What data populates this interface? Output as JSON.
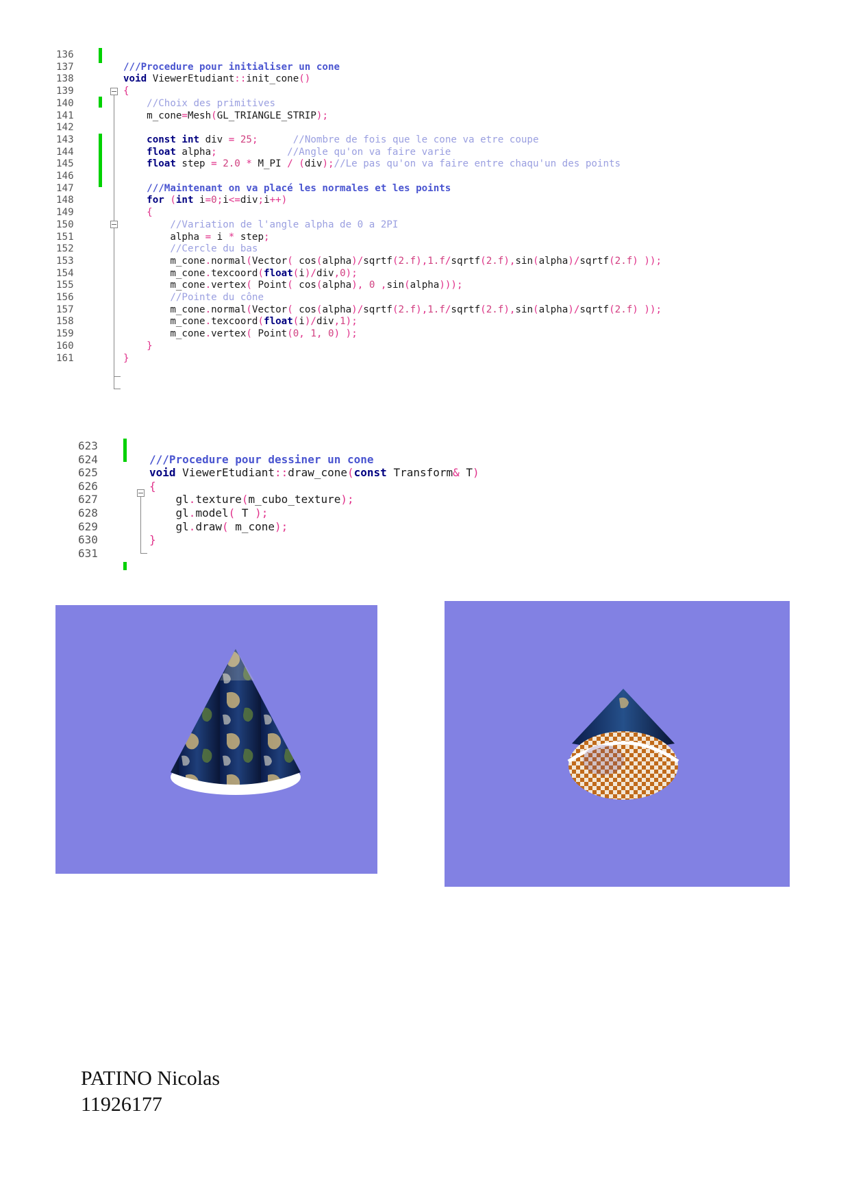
{
  "code_block_1": {
    "lines": [
      {
        "num": "136",
        "tokens": []
      },
      {
        "num": "137",
        "tokens": [
          {
            "t": "///Procedure pour initialiser un cone",
            "c": "t-dc"
          }
        ]
      },
      {
        "num": "138",
        "tokens": [
          {
            "t": "void",
            "c": "t-kw"
          },
          {
            "t": " ViewerEtudiant",
            "c": "t-pl"
          },
          {
            "t": "::",
            "c": "t-op"
          },
          {
            "t": "init_cone",
            "c": "t-pl"
          },
          {
            "t": "()",
            "c": "t-op"
          }
        ]
      },
      {
        "num": "139",
        "tokens": [
          {
            "t": "{",
            "c": "t-op"
          }
        ]
      },
      {
        "num": "140",
        "tokens": [
          {
            "t": "    //Choix des primitives",
            "c": "t-cm"
          }
        ]
      },
      {
        "num": "141",
        "tokens": [
          {
            "t": "    m_cone",
            "c": "t-pl"
          },
          {
            "t": "=",
            "c": "t-op"
          },
          {
            "t": "Mesh",
            "c": "t-pl"
          },
          {
            "t": "(",
            "c": "t-op"
          },
          {
            "t": "GL_TRIANGLE_STRIP",
            "c": "t-pl"
          },
          {
            "t": ");",
            "c": "t-op"
          }
        ]
      },
      {
        "num": "142",
        "tokens": []
      },
      {
        "num": "143",
        "tokens": [
          {
            "t": "    const int",
            "c": "t-kw"
          },
          {
            "t": " div ",
            "c": "t-pl"
          },
          {
            "t": "=",
            "c": "t-op"
          },
          {
            "t": " 25",
            "c": "t-nm"
          },
          {
            "t": ";",
            "c": "t-op"
          },
          {
            "t": "      //Nombre de fois que le cone va etre coupe",
            "c": "t-cm"
          }
        ]
      },
      {
        "num": "144",
        "tokens": [
          {
            "t": "    float",
            "c": "t-kw"
          },
          {
            "t": " alpha",
            "c": "t-pl"
          },
          {
            "t": ";",
            "c": "t-op"
          },
          {
            "t": "            //Angle qu'on va faire varie",
            "c": "t-cm"
          }
        ]
      },
      {
        "num": "145",
        "tokens": [
          {
            "t": "    float",
            "c": "t-kw"
          },
          {
            "t": " step ",
            "c": "t-pl"
          },
          {
            "t": "=",
            "c": "t-op"
          },
          {
            "t": " 2.0",
            "c": "t-nm"
          },
          {
            "t": " * ",
            "c": "t-op"
          },
          {
            "t": "M_PI ",
            "c": "t-pl"
          },
          {
            "t": "/",
            "c": "t-op"
          },
          {
            "t": " (",
            "c": "t-op"
          },
          {
            "t": "div",
            "c": "t-pl"
          },
          {
            "t": ");",
            "c": "t-op"
          },
          {
            "t": "//Le pas qu'on va faire entre chaqu'un des points",
            "c": "t-cm"
          }
        ]
      },
      {
        "num": "146",
        "tokens": []
      },
      {
        "num": "147",
        "tokens": [
          {
            "t": "    ///Maintenant on va placé les normales et les points",
            "c": "t-dc"
          }
        ]
      },
      {
        "num": "148",
        "tokens": [
          {
            "t": "    for",
            "c": "t-kw"
          },
          {
            "t": " (",
            "c": "t-op"
          },
          {
            "t": "int",
            "c": "t-kw"
          },
          {
            "t": " i",
            "c": "t-pl"
          },
          {
            "t": "=",
            "c": "t-op"
          },
          {
            "t": "0",
            "c": "t-nm"
          },
          {
            "t": ";",
            "c": "t-op"
          },
          {
            "t": "i",
            "c": "t-pl"
          },
          {
            "t": "<=",
            "c": "t-op"
          },
          {
            "t": "div",
            "c": "t-pl"
          },
          {
            "t": ";",
            "c": "t-op"
          },
          {
            "t": "i",
            "c": "t-pl"
          },
          {
            "t": "++)",
            "c": "t-op"
          }
        ]
      },
      {
        "num": "149",
        "tokens": [
          {
            "t": "    {",
            "c": "t-op"
          }
        ]
      },
      {
        "num": "150",
        "tokens": [
          {
            "t": "        //Variation de l'angle alpha de 0 a 2PI",
            "c": "t-cm"
          }
        ]
      },
      {
        "num": "151",
        "tokens": [
          {
            "t": "        alpha ",
            "c": "t-pl"
          },
          {
            "t": "=",
            "c": "t-op"
          },
          {
            "t": " i ",
            "c": "t-pl"
          },
          {
            "t": "*",
            "c": "t-op"
          },
          {
            "t": " step",
            "c": "t-pl"
          },
          {
            "t": ";",
            "c": "t-op"
          }
        ]
      },
      {
        "num": "152",
        "tokens": [
          {
            "t": "        //Cercle du bas",
            "c": "t-cm"
          }
        ]
      },
      {
        "num": "153",
        "tokens": [
          {
            "t": "        m_cone",
            "c": "t-pl"
          },
          {
            "t": ".",
            "c": "t-op"
          },
          {
            "t": "normal",
            "c": "t-pl"
          },
          {
            "t": "(",
            "c": "t-op"
          },
          {
            "t": "Vector",
            "c": "t-pl"
          },
          {
            "t": "( ",
            "c": "t-op"
          },
          {
            "t": "cos",
            "c": "t-pl"
          },
          {
            "t": "(",
            "c": "t-op"
          },
          {
            "t": "alpha",
            "c": "t-pl"
          },
          {
            "t": ")/",
            "c": "t-op"
          },
          {
            "t": "sqrtf",
            "c": "t-pl"
          },
          {
            "t": "(",
            "c": "t-op"
          },
          {
            "t": "2.f",
            "c": "t-nm"
          },
          {
            "t": "),",
            "c": "t-op"
          },
          {
            "t": "1.f",
            "c": "t-nm"
          },
          {
            "t": "/",
            "c": "t-op"
          },
          {
            "t": "sqrtf",
            "c": "t-pl"
          },
          {
            "t": "(",
            "c": "t-op"
          },
          {
            "t": "2.f",
            "c": "t-nm"
          },
          {
            "t": "),",
            "c": "t-op"
          },
          {
            "t": "sin",
            "c": "t-pl"
          },
          {
            "t": "(",
            "c": "t-op"
          },
          {
            "t": "alpha",
            "c": "t-pl"
          },
          {
            "t": ")/",
            "c": "t-op"
          },
          {
            "t": "sqrtf",
            "c": "t-pl"
          },
          {
            "t": "(",
            "c": "t-op"
          },
          {
            "t": "2.f",
            "c": "t-nm"
          },
          {
            "t": ") ));",
            "c": "t-op"
          }
        ]
      },
      {
        "num": "154",
        "tokens": [
          {
            "t": "        m_cone",
            "c": "t-pl"
          },
          {
            "t": ".",
            "c": "t-op"
          },
          {
            "t": "texcoord",
            "c": "t-pl"
          },
          {
            "t": "(",
            "c": "t-op"
          },
          {
            "t": "float",
            "c": "t-kw"
          },
          {
            "t": "(",
            "c": "t-op"
          },
          {
            "t": "i",
            "c": "t-pl"
          },
          {
            "t": ")/",
            "c": "t-op"
          },
          {
            "t": "div",
            "c": "t-pl"
          },
          {
            "t": ",",
            "c": "t-op"
          },
          {
            "t": "0",
            "c": "t-nm"
          },
          {
            "t": ");",
            "c": "t-op"
          }
        ]
      },
      {
        "num": "155",
        "tokens": [
          {
            "t": "        m_cone",
            "c": "t-pl"
          },
          {
            "t": ".",
            "c": "t-op"
          },
          {
            "t": "vertex",
            "c": "t-pl"
          },
          {
            "t": "( ",
            "c": "t-op"
          },
          {
            "t": "Point",
            "c": "t-pl"
          },
          {
            "t": "( ",
            "c": "t-op"
          },
          {
            "t": "cos",
            "c": "t-pl"
          },
          {
            "t": "(",
            "c": "t-op"
          },
          {
            "t": "alpha",
            "c": "t-pl"
          },
          {
            "t": "), ",
            "c": "t-op"
          },
          {
            "t": "0",
            "c": "t-nm"
          },
          {
            "t": " ,",
            "c": "t-op"
          },
          {
            "t": "sin",
            "c": "t-pl"
          },
          {
            "t": "(",
            "c": "t-op"
          },
          {
            "t": "alpha",
            "c": "t-pl"
          },
          {
            "t": ")));",
            "c": "t-op"
          }
        ]
      },
      {
        "num": "156",
        "tokens": [
          {
            "t": "        //Pointe du cône",
            "c": "t-cm"
          }
        ]
      },
      {
        "num": "157",
        "tokens": [
          {
            "t": "        m_cone",
            "c": "t-pl"
          },
          {
            "t": ".",
            "c": "t-op"
          },
          {
            "t": "normal",
            "c": "t-pl"
          },
          {
            "t": "(",
            "c": "t-op"
          },
          {
            "t": "Vector",
            "c": "t-pl"
          },
          {
            "t": "( ",
            "c": "t-op"
          },
          {
            "t": "cos",
            "c": "t-pl"
          },
          {
            "t": "(",
            "c": "t-op"
          },
          {
            "t": "alpha",
            "c": "t-pl"
          },
          {
            "t": ")/",
            "c": "t-op"
          },
          {
            "t": "sqrtf",
            "c": "t-pl"
          },
          {
            "t": "(",
            "c": "t-op"
          },
          {
            "t": "2.f",
            "c": "t-nm"
          },
          {
            "t": "),",
            "c": "t-op"
          },
          {
            "t": "1.f",
            "c": "t-nm"
          },
          {
            "t": "/",
            "c": "t-op"
          },
          {
            "t": "sqrtf",
            "c": "t-pl"
          },
          {
            "t": "(",
            "c": "t-op"
          },
          {
            "t": "2.f",
            "c": "t-nm"
          },
          {
            "t": "),",
            "c": "t-op"
          },
          {
            "t": "sin",
            "c": "t-pl"
          },
          {
            "t": "(",
            "c": "t-op"
          },
          {
            "t": "alpha",
            "c": "t-pl"
          },
          {
            "t": ")/",
            "c": "t-op"
          },
          {
            "t": "sqrtf",
            "c": "t-pl"
          },
          {
            "t": "(",
            "c": "t-op"
          },
          {
            "t": "2.f",
            "c": "t-nm"
          },
          {
            "t": ") ));",
            "c": "t-op"
          }
        ]
      },
      {
        "num": "158",
        "tokens": [
          {
            "t": "        m_cone",
            "c": "t-pl"
          },
          {
            "t": ".",
            "c": "t-op"
          },
          {
            "t": "texcoord",
            "c": "t-pl"
          },
          {
            "t": "(",
            "c": "t-op"
          },
          {
            "t": "float",
            "c": "t-kw"
          },
          {
            "t": "(",
            "c": "t-op"
          },
          {
            "t": "i",
            "c": "t-pl"
          },
          {
            "t": ")/",
            "c": "t-op"
          },
          {
            "t": "div",
            "c": "t-pl"
          },
          {
            "t": ",",
            "c": "t-op"
          },
          {
            "t": "1",
            "c": "t-nm"
          },
          {
            "t": ");",
            "c": "t-op"
          }
        ]
      },
      {
        "num": "159",
        "tokens": [
          {
            "t": "        m_cone",
            "c": "t-pl"
          },
          {
            "t": ".",
            "c": "t-op"
          },
          {
            "t": "vertex",
            "c": "t-pl"
          },
          {
            "t": "( ",
            "c": "t-op"
          },
          {
            "t": "Point",
            "c": "t-pl"
          },
          {
            "t": "(",
            "c": "t-op"
          },
          {
            "t": "0",
            "c": "t-nm"
          },
          {
            "t": ", ",
            "c": "t-op"
          },
          {
            "t": "1",
            "c": "t-nm"
          },
          {
            "t": ", ",
            "c": "t-op"
          },
          {
            "t": "0",
            "c": "t-nm"
          },
          {
            "t": ") );",
            "c": "t-op"
          }
        ]
      },
      {
        "num": "160",
        "tokens": [
          {
            "t": "    }",
            "c": "t-op"
          }
        ]
      },
      {
        "num": "161",
        "tokens": [
          {
            "t": "}",
            "c": "t-op"
          }
        ]
      }
    ]
  },
  "code_block_2": {
    "lines": [
      {
        "num": "623",
        "tokens": []
      },
      {
        "num": "624",
        "tokens": [
          {
            "t": "///Procedure pour dessiner un cone",
            "c": "t-dc"
          }
        ]
      },
      {
        "num": "625",
        "tokens": [
          {
            "t": "void",
            "c": "t-kw"
          },
          {
            "t": " ViewerEtudiant",
            "c": "t-pl"
          },
          {
            "t": "::",
            "c": "t-op"
          },
          {
            "t": "draw_cone",
            "c": "t-pl"
          },
          {
            "t": "(",
            "c": "t-op"
          },
          {
            "t": "const",
            "c": "t-kw"
          },
          {
            "t": " Transform",
            "c": "t-pl"
          },
          {
            "t": "&",
            "c": "t-op"
          },
          {
            "t": " T",
            "c": "t-pl"
          },
          {
            "t": ")",
            "c": "t-op"
          }
        ]
      },
      {
        "num": "626",
        "tokens": [
          {
            "t": "{",
            "c": "t-op"
          }
        ]
      },
      {
        "num": "627",
        "tokens": [
          {
            "t": "    gl",
            "c": "t-pl"
          },
          {
            "t": ".",
            "c": "t-op"
          },
          {
            "t": "texture",
            "c": "t-pl"
          },
          {
            "t": "(",
            "c": "t-op"
          },
          {
            "t": "m_cubo_texture",
            "c": "t-pl"
          },
          {
            "t": ");",
            "c": "t-op"
          }
        ]
      },
      {
        "num": "628",
        "tokens": [
          {
            "t": "    gl",
            "c": "t-pl"
          },
          {
            "t": ".",
            "c": "t-op"
          },
          {
            "t": "model",
            "c": "t-pl"
          },
          {
            "t": "( ",
            "c": "t-op"
          },
          {
            "t": "T",
            "c": "t-pl"
          },
          {
            "t": " );",
            "c": "t-op"
          }
        ]
      },
      {
        "num": "629",
        "tokens": [
          {
            "t": "    gl",
            "c": "t-pl"
          },
          {
            "t": ".",
            "c": "t-op"
          },
          {
            "t": "draw",
            "c": "t-pl"
          },
          {
            "t": "( ",
            "c": "t-op"
          },
          {
            "t": "m_cone",
            "c": "t-pl"
          },
          {
            "t": ");",
            "c": "t-op"
          }
        ]
      },
      {
        "num": "630",
        "tokens": [
          {
            "t": "}",
            "c": "t-op"
          }
        ]
      },
      {
        "num": "631",
        "tokens": []
      }
    ]
  },
  "colors": {
    "viewport_bg": "#8281e3",
    "gutter_marker": "#00d100",
    "keyword": "#000080",
    "doc_comment": "#4a55d0",
    "comment": "#9a9fe0",
    "operator": "#e0308a"
  },
  "author": {
    "name": "PATINO Nicolas",
    "student_id": "11926177"
  }
}
